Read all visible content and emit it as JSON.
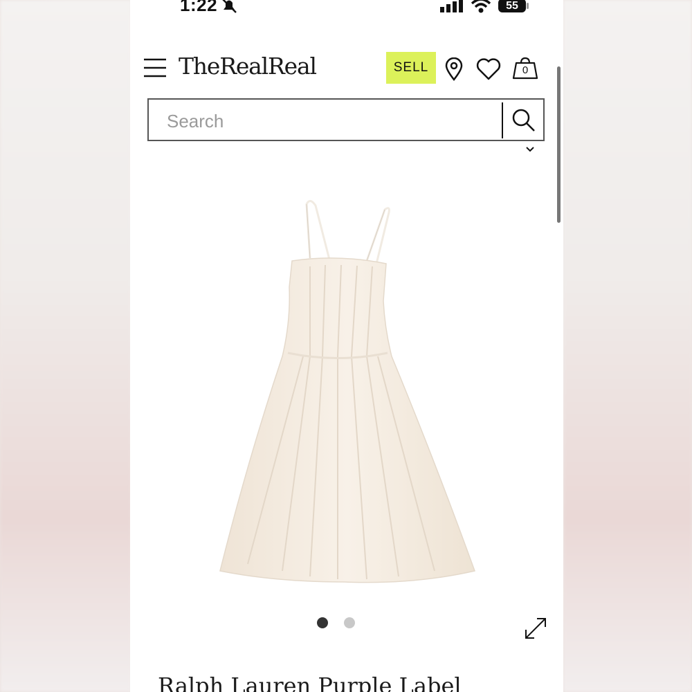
{
  "status_bar": {
    "time": "1:22",
    "battery": "55"
  },
  "header": {
    "logo": "TheRealReal",
    "sell_label": "SELL",
    "bag_count": "0"
  },
  "search": {
    "placeholder": "Search"
  },
  "carousel": {
    "total_images": 2,
    "active_index": 1
  },
  "product": {
    "title": "Ralph Lauren Purple Label"
  },
  "colors": {
    "sell_accent": "#dcf15a",
    "dress": "#f5ede3"
  },
  "icons": [
    "bell-slash-icon",
    "signal-icon",
    "wifi-icon",
    "menu-icon",
    "location-pin-icon",
    "heart-icon",
    "shopping-bag-icon",
    "search-icon",
    "chevron-down-icon",
    "expand-icon"
  ]
}
